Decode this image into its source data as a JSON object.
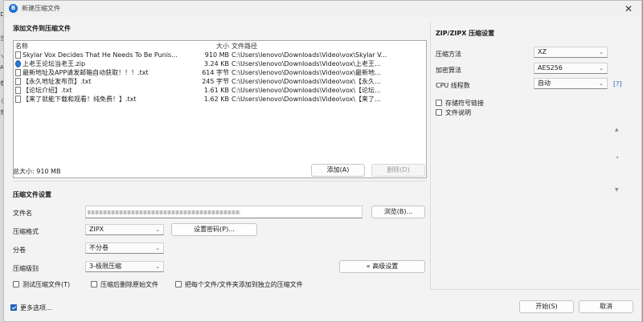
{
  "background": {
    "side_chars": [
      "D",
      "当",
      "↘",
      "As",
      "卷",
      "",
      "(",
      "东"
    ]
  },
  "window": {
    "title": "新建压缩文件",
    "close_glyph": "✕",
    "app_icon_glyph": "B"
  },
  "add_files": {
    "section_title": "添加文件到压缩文件",
    "columns": {
      "name": "名称",
      "size": "大小",
      "path": "文件路径"
    },
    "files": [
      {
        "icon": "file-icon",
        "name": "Skylar Vox Decides That He Needs To Be Punis...",
        "size": "910 MB",
        "path": "C:\\Users\\lenovo\\Downloads\\Video\\vox\\Skylar V..."
      },
      {
        "icon": "globe-icon",
        "name": "上老王论坛当老王.zip",
        "size": "3.24 KB",
        "path": "C:\\Users\\lenovo\\Downloads\\Video\\vox\\上老王..."
      },
      {
        "icon": "file-icon",
        "name": "最新地址及APP请发邮箱自动获取！！！.txt",
        "size": "614 字节",
        "path": "C:\\Users\\lenovo\\Downloads\\Video\\vox\\最新地..."
      },
      {
        "icon": "file-icon",
        "name": "【永久地址发布页】.txt",
        "size": "245 字节",
        "path": "C:\\Users\\lenovo\\Downloads\\Video\\vox\\【永久..."
      },
      {
        "icon": "file-icon",
        "name": "【论坛介绍】.txt",
        "size": "1.61 KB",
        "path": "C:\\Users\\lenovo\\Downloads\\Video\\vox\\【论坛..."
      },
      {
        "icon": "file-icon",
        "name": "【来了就能下载和观看！纯免费！】.txt",
        "size": "1.62 KB",
        "path": "C:\\Users\\lenovo\\Downloads\\Video\\vox\\【来了..."
      }
    ],
    "total_label": "总大小: 910 MB",
    "add_button": "添加(A)",
    "delete_button": "删除(D)"
  },
  "archive_settings": {
    "section_title": "压缩文件设置",
    "filename_label": "文件名",
    "browse_button": "浏览(B)...",
    "format_label": "压缩格式",
    "format_value": "ZIPX",
    "set_password_button": "设置密码(P)...",
    "split_label": "分卷",
    "split_value": "不分卷",
    "level_label": "压缩级别",
    "level_value": "3-极限压缩",
    "advanced_button": "« 高级设置",
    "test_archive": "测试压缩文件(T)",
    "delete_after": "压缩后删除原始文件",
    "separate_archives": "把每个文件/文件夹添加到独立的压缩文件"
  },
  "zip_settings": {
    "section_title": "ZIP/ZIPX 压缩设置",
    "method_label": "压缩方法",
    "method_value": "XZ",
    "encryption_label": "加密算法",
    "encryption_value": "AES256",
    "threads_label": "CPU 线程数",
    "threads_value": "自动",
    "help_link": "[?]",
    "store_symlinks": "存储符号链接",
    "file_comment": "文件说明"
  },
  "footer": {
    "more_options": "更多选项...",
    "more_options_checked": true,
    "start_button": "开始(S)",
    "cancel_button": "取消"
  },
  "colors": {
    "accent": "#1d5fb8",
    "window_bg": "#f3f3f3"
  }
}
